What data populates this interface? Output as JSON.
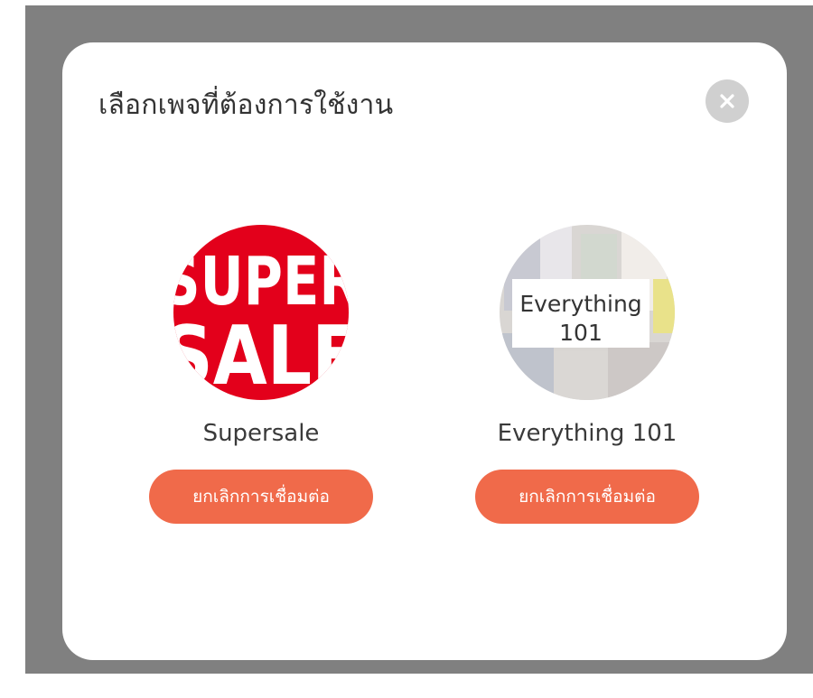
{
  "modal": {
    "title": "เลือกเพจที่ต้องการใช้งาน",
    "close_icon": "close-icon"
  },
  "pages": [
    {
      "name": "Supersale",
      "logo_text": [
        "SUPER",
        "SALE"
      ],
      "button_label": "ยกเลิกการเชื่อมต่อ"
    },
    {
      "name": "Everything 101",
      "logo_text": [
        "Everything",
        "101"
      ],
      "button_label": "ยกเลิกการเชื่อมต่อ"
    }
  ],
  "colors": {
    "overlay": "#808080",
    "button": "#f06a4a",
    "close_button": "#d0d0d0",
    "supersale_red": "#e3001b"
  }
}
